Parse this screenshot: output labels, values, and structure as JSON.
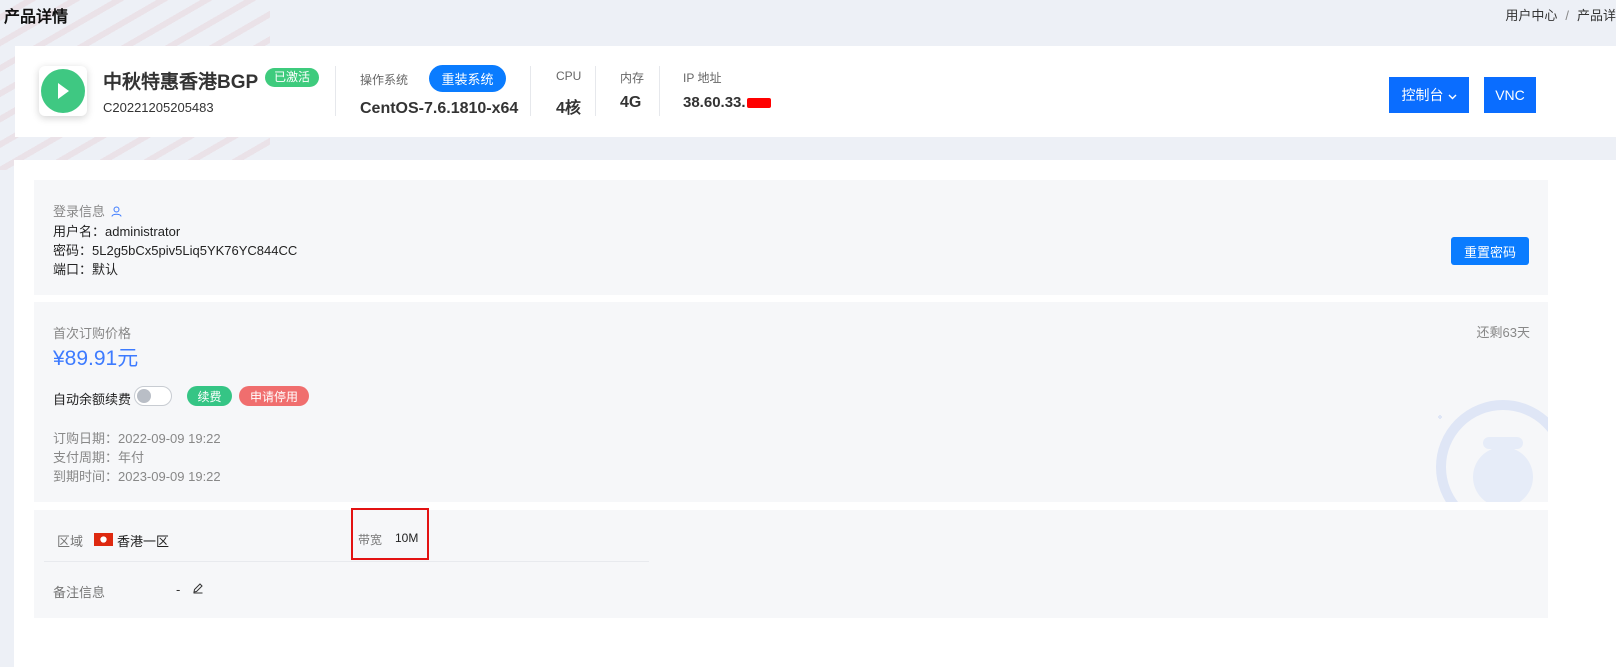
{
  "page": {
    "title": "产品详情",
    "breadcrumb": [
      "用户中心",
      "产品详"
    ]
  },
  "header": {
    "product_name": "中秋特惠香港BGP",
    "status": "已激活",
    "product_id": "C20221205205483",
    "os_label": "操作系统",
    "os_value": "CentOS-7.6.1810-x64",
    "reinstall_button": "重装系统",
    "cpu_label": "CPU",
    "cpu_value": "4核",
    "memory_label": "内存",
    "memory_value": "4G",
    "ip_label": "IP 地址",
    "ip_value": "38.60.33.",
    "console_button": "控制台",
    "vnc_button": "VNC"
  },
  "login": {
    "title": "登录信息",
    "username_label": "用户名：",
    "username": "administrator",
    "password_label": "密码：",
    "password": "5L2g5bCx5piv5Liq5YK76YC844CC",
    "port_label": "端口：",
    "port": "默认",
    "reset_button": "重置密码"
  },
  "billing": {
    "price_label": "首次订购价格",
    "price": "¥89.91元",
    "remaining": "还剩63天",
    "auto_renew_label": "自动余额续费",
    "auto_renew_enabled": false,
    "renew_button": "续费",
    "stop_button": "申请停用",
    "order_date": "订购日期：2022-09-09 19:22",
    "pay_cycle": "支付周期：年付",
    "expire_time": "到期时间：2023-09-09 19:22"
  },
  "extra": {
    "region_label": "区域",
    "region_value": "香港一区",
    "bandwidth_label": "带宽",
    "bandwidth_value": "10M",
    "note_label": "备注信息",
    "note_value": "-"
  },
  "colors": {
    "primary": "#0a7cff",
    "success": "#35c585",
    "danger": "#f06e6e",
    "price": "#3d7bff",
    "highlight_border": "#e31212"
  }
}
